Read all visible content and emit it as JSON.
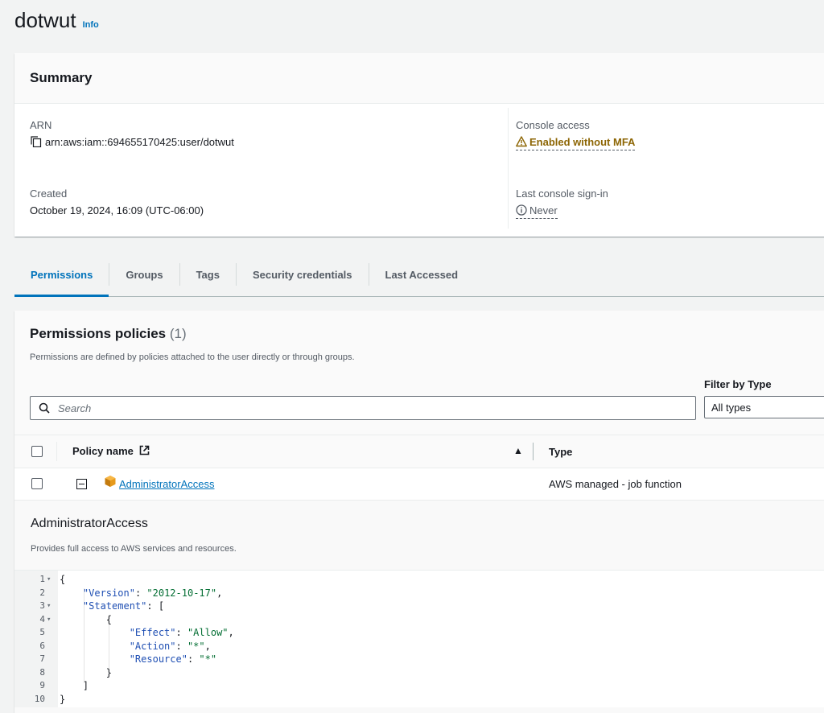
{
  "page": {
    "title": "dotwut",
    "info_link": "Info"
  },
  "summary": {
    "heading": "Summary",
    "arn_label": "ARN",
    "arn_value": "arn:aws:iam::694655170425:user/dotwut",
    "console_access_label": "Console access",
    "console_access_value": "Enabled without MFA",
    "created_label": "Created",
    "created_value": "October 19, 2024, 16:09 (UTC-06:00)",
    "last_signin_label": "Last console sign-in",
    "last_signin_value": "Never"
  },
  "tabs": [
    {
      "label": "Permissions",
      "active": true
    },
    {
      "label": "Groups",
      "active": false
    },
    {
      "label": "Tags",
      "active": false
    },
    {
      "label": "Security credentials",
      "active": false
    },
    {
      "label": "Last Accessed",
      "active": false
    }
  ],
  "permissions": {
    "title": "Permissions policies",
    "count": "(1)",
    "description": "Permissions are defined by policies attached to the user directly or through groups.",
    "filter_label": "Filter by Type",
    "search_placeholder": "Search",
    "type_selected": "All types",
    "columns": {
      "policy_name": "Policy name",
      "type": "Type"
    },
    "rows": [
      {
        "policy_name": "AdministratorAccess",
        "type": "AWS managed - job function"
      }
    ]
  },
  "policy_detail": {
    "title": "AdministratorAccess",
    "description": "Provides full access to AWS services and resources.",
    "code_lines": [
      {
        "n": "1",
        "fold": true,
        "text": "{"
      },
      {
        "n": "2",
        "fold": false,
        "text": "    \"Version\": \"2012-10-17\","
      },
      {
        "n": "3",
        "fold": true,
        "text": "    \"Statement\": ["
      },
      {
        "n": "4",
        "fold": true,
        "text": "        {"
      },
      {
        "n": "5",
        "fold": false,
        "text": "            \"Effect\": \"Allow\","
      },
      {
        "n": "6",
        "fold": false,
        "text": "            \"Action\": \"*\","
      },
      {
        "n": "7",
        "fold": false,
        "text": "            \"Resource\": \"*\""
      },
      {
        "n": "8",
        "fold": false,
        "text": "        }"
      },
      {
        "n": "9",
        "fold": false,
        "text": "    ]"
      },
      {
        "n": "10",
        "fold": false,
        "text": "}"
      }
    ]
  },
  "colors": {
    "accent": "#0073bb",
    "warning": "#8d6605",
    "background": "#f2f3f3"
  }
}
